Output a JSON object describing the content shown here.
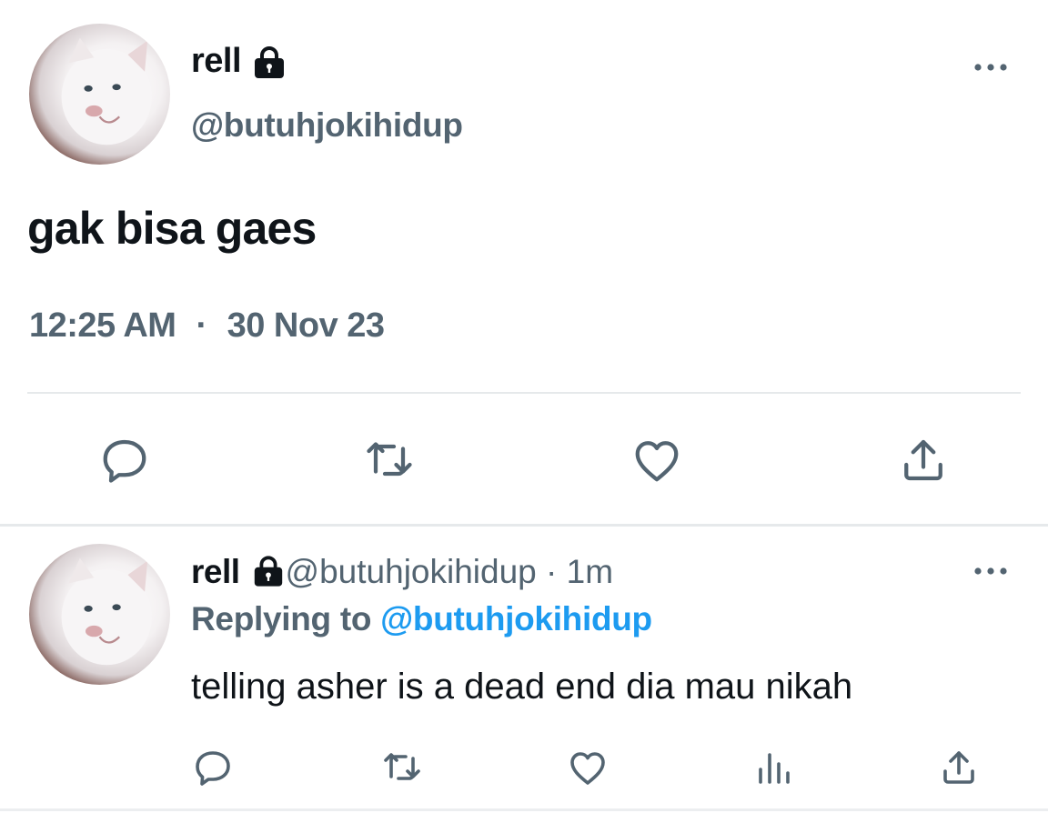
{
  "main_tweet": {
    "author_name": "rell",
    "lock_icon": "lock-icon",
    "handle": "@butuhjokihidup",
    "more_icon": "more-horizontal-icon",
    "text": "gak bisa gaes",
    "time": "12:25 AM",
    "separator": "·",
    "date": "30 Nov 23",
    "actions": [
      "reply-icon",
      "retweet-icon",
      "like-icon",
      "share-icon"
    ]
  },
  "reply_tweet": {
    "author_name": "rell",
    "lock_icon": "lock-icon",
    "handle_time": "@butuhjokihidup · 1m",
    "replying_label": "Replying to",
    "replying_handle": "@butuhjokihidup",
    "text": "telling asher is a dead end dia mau nikah",
    "more_icon": "more-horizontal-icon",
    "actions": [
      "reply-icon",
      "retweet-icon",
      "like-icon",
      "analytics-icon",
      "share-icon"
    ]
  },
  "colors": {
    "text_primary": "#0f1419",
    "text_secondary": "#536471",
    "link": "#1d9bf0",
    "divider": "#e6e9eb"
  }
}
